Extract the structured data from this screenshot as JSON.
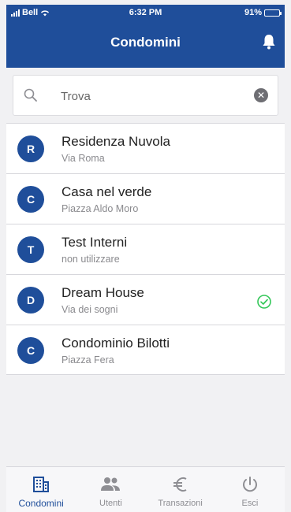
{
  "status_bar": {
    "carrier": "Bell",
    "time": "6:32 PM",
    "battery": "91%",
    "battery_level": 0.91
  },
  "header": {
    "title": "Condomini",
    "icon": "bell-icon"
  },
  "search": {
    "placeholder": "Trova",
    "value": ""
  },
  "condomini": [
    {
      "initial": "R",
      "name": "Residenza Nuvola",
      "address": "Via Roma",
      "selected": false
    },
    {
      "initial": "C",
      "name": "Casa nel verde",
      "address": "Piazza Aldo Moro",
      "selected": false
    },
    {
      "initial": "T",
      "name": "Test Interni",
      "address": "non utilizzare",
      "selected": false
    },
    {
      "initial": "D",
      "name": "Dream House",
      "address": "Via dei sogni",
      "selected": true
    },
    {
      "initial": "C",
      "name": "Condominio Bilotti",
      "address": "Piazza Fera",
      "selected": false
    }
  ],
  "tabs": [
    {
      "label": "Condomini",
      "icon": "building-icon",
      "active": true
    },
    {
      "label": "Utenti",
      "icon": "users-icon",
      "active": false
    },
    {
      "label": "Transazioni",
      "icon": "euro-icon",
      "active": false
    },
    {
      "label": "Esci",
      "icon": "power-icon",
      "active": false
    }
  ],
  "colors": {
    "primary": "#1f4e9a",
    "success": "#34c759",
    "inactive": "#8e8e93"
  }
}
